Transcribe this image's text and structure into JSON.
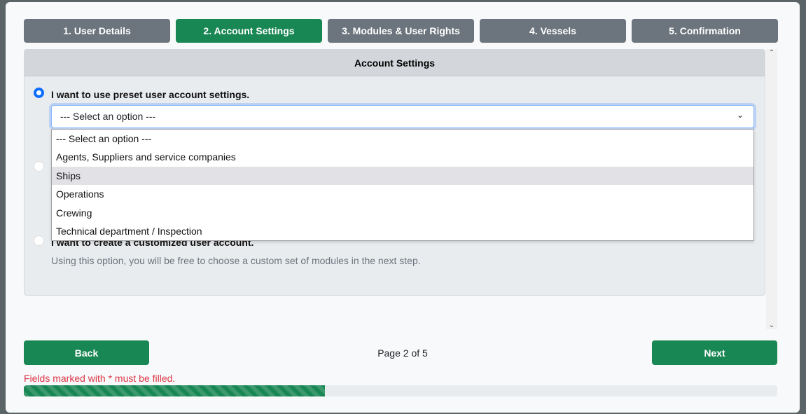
{
  "steps": [
    {
      "label": "1. User Details"
    },
    {
      "label": "2. Account Settings",
      "active": true
    },
    {
      "label": "3. Modules & User Rights"
    },
    {
      "label": "4. Vessels"
    },
    {
      "label": "5. Confirmation"
    }
  ],
  "panel": {
    "title": "Account Settings",
    "option1": {
      "label": "I want to use preset user account settings.",
      "selected": true
    },
    "option3": {
      "label": "I want to create a customized user account.",
      "hint": "Using this option, you will be free to choose a custom set of modules in the next step."
    },
    "select": {
      "value": "--- Select an option ---",
      "options": [
        "--- Select an option ---",
        "Agents, Suppliers and service companies",
        "Ships",
        "Operations",
        "Crewing",
        "Technical department / Inspection"
      ],
      "highlighted": "Ships"
    }
  },
  "footer": {
    "back": "Back",
    "next": "Next",
    "page": "Page 2 of 5",
    "error": "Fields marked with * must be filled.",
    "progress_percent": 40
  },
  "colors": {
    "accent": "#198754",
    "inactive": "#6c757d",
    "error": "#dc3545"
  }
}
